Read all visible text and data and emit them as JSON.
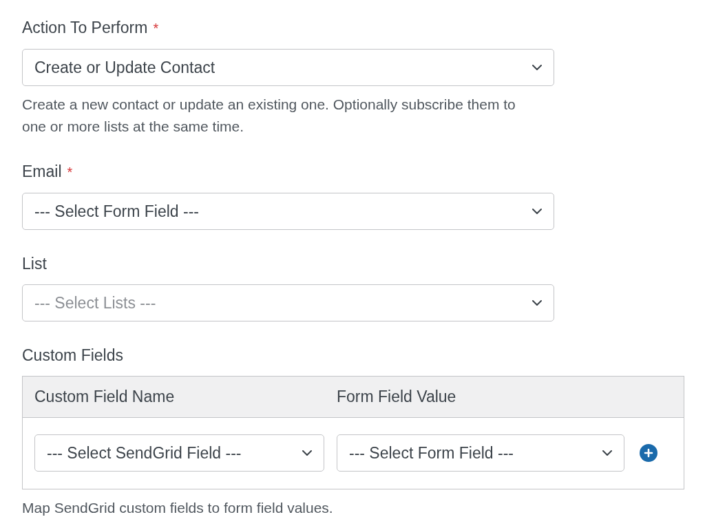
{
  "fields": [
    {
      "label": "Action To Perform",
      "required_mark": "*",
      "value": "Create or Update Contact",
      "description": "Create a new contact or update an existing one. Optionally subscribe them to one or more lists at the same time."
    },
    {
      "label": "Email",
      "required_mark": "*",
      "value": "--- Select Form Field ---"
    },
    {
      "label": "List",
      "placeholder": "--- Select Lists ---"
    }
  ],
  "custom_fields": {
    "label": "Custom Fields",
    "columns": [
      "Custom Field Name",
      "Form Field Value"
    ],
    "rows": [
      {
        "cells": [
          {
            "value": "--- Select SendGrid Field ---"
          },
          {
            "value": "--- Select Form Field ---"
          }
        ]
      }
    ],
    "description": "Map SendGrid custom fields to form field values."
  }
}
